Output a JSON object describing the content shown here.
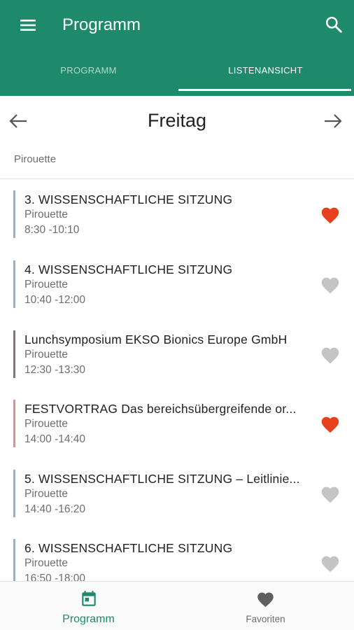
{
  "colors": {
    "primary": "#1e8a6b",
    "favorite_active": "#e8401c",
    "favorite_inactive": "#c4c4c4"
  },
  "appbar": {
    "title": "Programm",
    "menu_icon": "hamburger-menu-icon",
    "search_icon": "search-icon"
  },
  "tabs": [
    {
      "label": "PROGRAMM",
      "active": false
    },
    {
      "label": "LISTENANSICHT",
      "active": true
    }
  ],
  "day_nav": {
    "title": "Freitag",
    "prev_icon": "arrow-left-icon",
    "next_icon": "arrow-right-icon"
  },
  "section": {
    "label": "Pirouette"
  },
  "sessions": [
    {
      "title": "3. WISSENSCHAFTLICHE SITZUNG",
      "room": "Pirouette",
      "time": "8:30 -10:10",
      "favorite": true,
      "color": "#8fb4d2"
    },
    {
      "title": "4. WISSENSCHAFTLICHE SITZUNG",
      "room": "Pirouette",
      "time": "10:40 -12:00",
      "favorite": false,
      "color": "#8fb4d2"
    },
    {
      "title": "Lunchsymposium EKSO Bionics Europe GmbH",
      "room": "Pirouette",
      "time": "12:30 -13:30",
      "favorite": false,
      "color": "#8e6e78"
    },
    {
      "title": "FESTVORTRAG Das bereichsübergreifende or...",
      "room": "Pirouette",
      "time": "14:00 -14:40",
      "favorite": true,
      "color": "#e98b8b"
    },
    {
      "title": "5. WISSENSCHAFTLICHE SITZUNG – Leitlinie...",
      "room": "Pirouette",
      "time": "14:40 -16:20",
      "favorite": false,
      "color": "#8fb4d2"
    },
    {
      "title": "6. WISSENSCHAFTLICHE SITZUNG",
      "room": "Pirouette",
      "time": "16:50 -18:00",
      "favorite": false,
      "color": "#8fb4d2"
    }
  ],
  "bottom_nav": [
    {
      "label": "Programm",
      "icon": "calendar-icon",
      "active": true
    },
    {
      "label": "Favoriten",
      "icon": "heart-icon",
      "active": false
    }
  ]
}
